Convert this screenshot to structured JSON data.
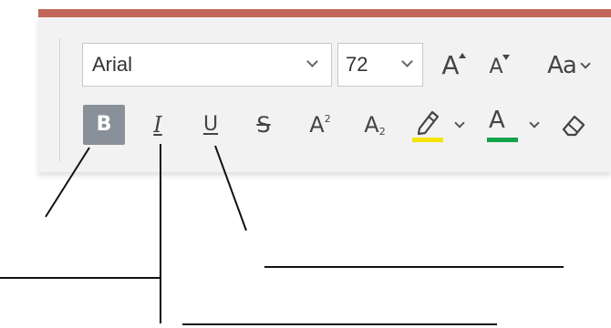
{
  "toolbar": {
    "font_name": "Arial",
    "font_size": "72",
    "grow_font_label": "A",
    "shrink_font_label": "A",
    "change_case_label": "Aa",
    "bold_label": "B",
    "italic_label": "I",
    "underline_label": "U",
    "strikethrough_label": "S",
    "superscript_label": "A",
    "superscript_mark": "2",
    "subscript_label": "A",
    "subscript_mark": "2",
    "font_color_label": "A"
  },
  "colors": {
    "accent_bar": "#c0675a",
    "highlight_swatch": "#f5e400",
    "font_color_swatch": "#12a24a",
    "bold_active_bg": "#8a9099"
  },
  "icons": {
    "grow": "grow-font-icon",
    "shrink": "shrink-font-icon",
    "highlight": "highlighter-pen-icon",
    "eraser": "clear-formatting-eraser-icon"
  }
}
